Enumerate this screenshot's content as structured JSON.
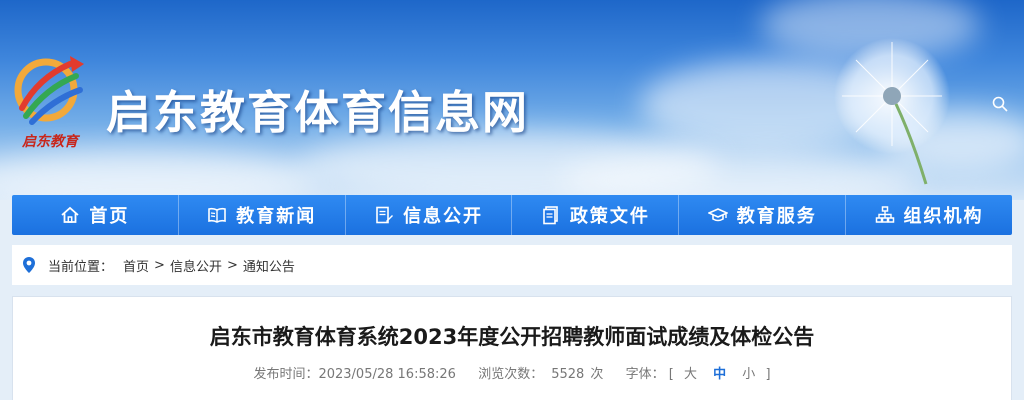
{
  "header": {
    "site_title": "启东教育体育信息网",
    "logo_text": "启东教育"
  },
  "nav": {
    "items": [
      {
        "label": "首页",
        "icon": "home-icon"
      },
      {
        "label": "教育新闻",
        "icon": "book-icon"
      },
      {
        "label": "信息公开",
        "icon": "document-edit-icon"
      },
      {
        "label": "政策文件",
        "icon": "file-icon"
      },
      {
        "label": "教育服务",
        "icon": "graduation-cap-icon"
      },
      {
        "label": "组织机构",
        "icon": "org-chart-icon"
      }
    ]
  },
  "breadcrumb": {
    "label": "当前位置：",
    "items": [
      "首页",
      "信息公开",
      "通知公告"
    ],
    "separator": ">"
  },
  "article": {
    "title": "启东市教育体育系统2023年度公开招聘教师面试成绩及体检公告",
    "publish_label": "发布时间：",
    "publish_time": "2023/05/28 16:58:26",
    "views_label": "浏览次数：",
    "views": "5528",
    "views_unit": "次",
    "font_label": "字体：",
    "bracket_open": "[",
    "bracket_close": "]",
    "font_sizes": [
      "大",
      "中",
      "小"
    ],
    "font_size_selected": "中"
  },
  "colors": {
    "nav_bg": "#1f76e6",
    "accent": "#1e6fd8",
    "page_bg": "#e4eef8"
  }
}
